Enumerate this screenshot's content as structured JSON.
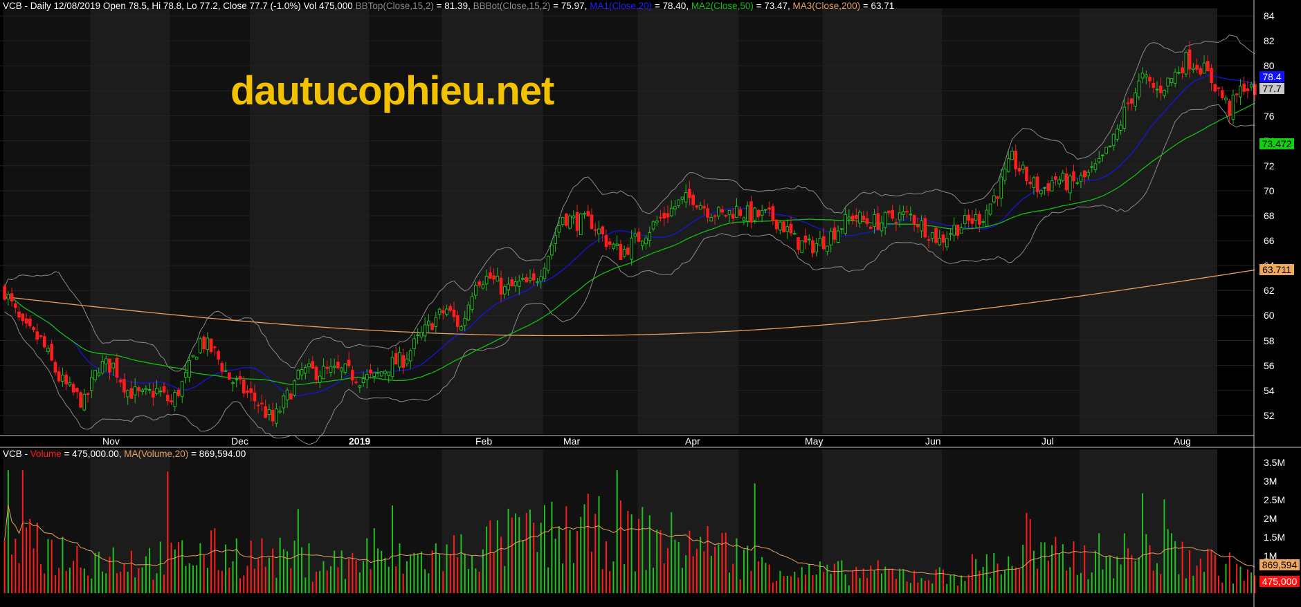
{
  "header_price": {
    "prefix": "VCB - Daily 12/08/2019 Open 78.5, Hi 78.8, Lo 77.2, Close 77.7 (-1.0%) Vol 475,000",
    "bbtop_label": "BBTop(Close,15,2)",
    "bbtop_value": " = 81.39,",
    "bbbot_label": "BBBot(Close,15,2)",
    "bbbot_value": " = 75.97,",
    "ma1_label": "MA1(Close,20)",
    "ma1_value": " = 78.40,",
    "ma2_label": "MA2(Close,50)",
    "ma2_value": " = 73.47,",
    "ma3_label": "MA3(Close,200)",
    "ma3_value": " = 63.71"
  },
  "header_volume": {
    "prefix": "VCB - ",
    "vol_label": "Volume",
    "vol_value": " = 475,000.00,",
    "ma_label": "MA(Volume,20)",
    "ma_value": " = 869,594.00"
  },
  "watermark": "dautucophieu.net",
  "badges": {
    "ma1": "78.4",
    "close": "77.7",
    "ma2": "73.472",
    "ma3": "63.711",
    "vol_ma": "869,594",
    "vol": "475,000"
  },
  "colors": {
    "up": "#20c020",
    "down": "#ff1c1c",
    "ma1": "#1515e0",
    "ma2": "#10c010",
    "ma3": "#e8a060",
    "bb": "#8c8c8c",
    "watermark": "#f2c200"
  },
  "chart_data": {
    "type": "candlestick",
    "symbol": "VCB",
    "timeframe": "Daily",
    "last_bar": {
      "date": "12/08/2019",
      "open": 78.5,
      "high": 78.8,
      "low": 77.2,
      "close": 77.7,
      "change_pct": -1.0,
      "volume": 475000
    },
    "price_axis": {
      "ticks": [
        52,
        54,
        56,
        58,
        60,
        62,
        64,
        66,
        68,
        70,
        72,
        74,
        76,
        78,
        80,
        82,
        84
      ],
      "ylim": [
        50.5,
        84.5
      ]
    },
    "volume_axis": {
      "ticks": [
        "1M",
        "1.5M",
        "2M",
        "2.5M",
        "3M",
        "3.5M"
      ],
      "ylim": [
        0,
        3600000
      ]
    },
    "month_labels": [
      "Nov",
      "Dec",
      "2019",
      "Feb",
      "Mar",
      "Apr",
      "May",
      "Jun",
      "Jul",
      "Aug"
    ],
    "price_anchors": [
      [
        0,
        62
      ],
      [
        5,
        59
      ],
      [
        10,
        58
      ],
      [
        15,
        55
      ],
      [
        18,
        54
      ],
      [
        22,
        53
      ],
      [
        26,
        56
      ],
      [
        30,
        56
      ],
      [
        34,
        54
      ],
      [
        38,
        53.5
      ],
      [
        42,
        54
      ],
      [
        46,
        53
      ],
      [
        50,
        55
      ],
      [
        54,
        58
      ],
      [
        58,
        57
      ],
      [
        62,
        55
      ],
      [
        66,
        54
      ],
      [
        70,
        53
      ],
      [
        74,
        51.5
      ],
      [
        78,
        53.5
      ],
      [
        82,
        55.5
      ],
      [
        86,
        55.5
      ],
      [
        90,
        55.5
      ],
      [
        94,
        55.5
      ],
      [
        98,
        55
      ],
      [
        102,
        55
      ],
      [
        106,
        56
      ],
      [
        110,
        56.5
      ],
      [
        114,
        58
      ],
      [
        118,
        59.5
      ],
      [
        122,
        60.5
      ],
      [
        126,
        59
      ],
      [
        130,
        63
      ],
      [
        134,
        63
      ],
      [
        138,
        62
      ],
      [
        142,
        62.5
      ],
      [
        146,
        62.5
      ],
      [
        150,
        65
      ],
      [
        154,
        68
      ],
      [
        158,
        67.5
      ],
      [
        162,
        67.5
      ],
      [
        166,
        66
      ],
      [
        170,
        65
      ],
      [
        174,
        66
      ],
      [
        178,
        67
      ],
      [
        182,
        68
      ],
      [
        186,
        69
      ],
      [
        190,
        69.5
      ],
      [
        194,
        68.5
      ],
      [
        198,
        68
      ],
      [
        202,
        68.5
      ],
      [
        206,
        68
      ],
      [
        210,
        68
      ],
      [
        214,
        67.5
      ],
      [
        218,
        66
      ],
      [
        222,
        65.5
      ],
      [
        226,
        66
      ],
      [
        230,
        67
      ],
      [
        234,
        68
      ],
      [
        238,
        67.5
      ],
      [
        242,
        67.5
      ],
      [
        246,
        68
      ],
      [
        250,
        68
      ],
      [
        254,
        67
      ],
      [
        258,
        66
      ],
      [
        262,
        67
      ],
      [
        266,
        67.5
      ],
      [
        270,
        68
      ],
      [
        274,
        70
      ],
      [
        278,
        72.5
      ],
      [
        282,
        71
      ],
      [
        286,
        70
      ],
      [
        290,
        71
      ],
      [
        294,
        70.5
      ],
      [
        298,
        71
      ],
      [
        302,
        72
      ],
      [
        306,
        74
      ],
      [
        310,
        77
      ],
      [
        314,
        79
      ],
      [
        318,
        78
      ],
      [
        322,
        79
      ],
      [
        326,
        80.5
      ],
      [
        330,
        80
      ],
      [
        334,
        78.5
      ],
      [
        338,
        76.5
      ],
      [
        342,
        78.5
      ],
      [
        345,
        77.7
      ]
    ],
    "volume_anchors": [
      [
        0,
        800000
      ],
      [
        1,
        3300000
      ],
      [
        2,
        1200000
      ],
      [
        10,
        1100000
      ],
      [
        20,
        900000
      ],
      [
        40,
        800000
      ],
      [
        60,
        1000000
      ],
      [
        80,
        800000
      ],
      [
        100,
        700000
      ],
      [
        120,
        900000
      ],
      [
        140,
        1300000
      ],
      [
        160,
        1500000
      ],
      [
        180,
        1300000
      ],
      [
        200,
        1000000
      ],
      [
        220,
        500000
      ],
      [
        240,
        500000
      ],
      [
        260,
        400000
      ],
      [
        270,
        700000
      ],
      [
        280,
        800000
      ],
      [
        300,
        900000
      ],
      [
        320,
        1000000
      ],
      [
        345,
        475000
      ]
    ],
    "volume_ma": {
      "name": "MA(Volume,20)",
      "last": 869594
    },
    "indicators": {
      "bb_top": {
        "name": "BBTop(Close,15,2)",
        "last": 81.39
      },
      "bb_bot": {
        "name": "BBBot(Close,15,2)",
        "last": 75.97
      },
      "ma1": {
        "name": "MA1(Close,20)",
        "last": 78.4
      },
      "ma2": {
        "name": "MA2(Close,50)",
        "last": 73.47
      },
      "ma3": {
        "name": "MA3(Close,200)",
        "last": 63.71
      }
    }
  }
}
